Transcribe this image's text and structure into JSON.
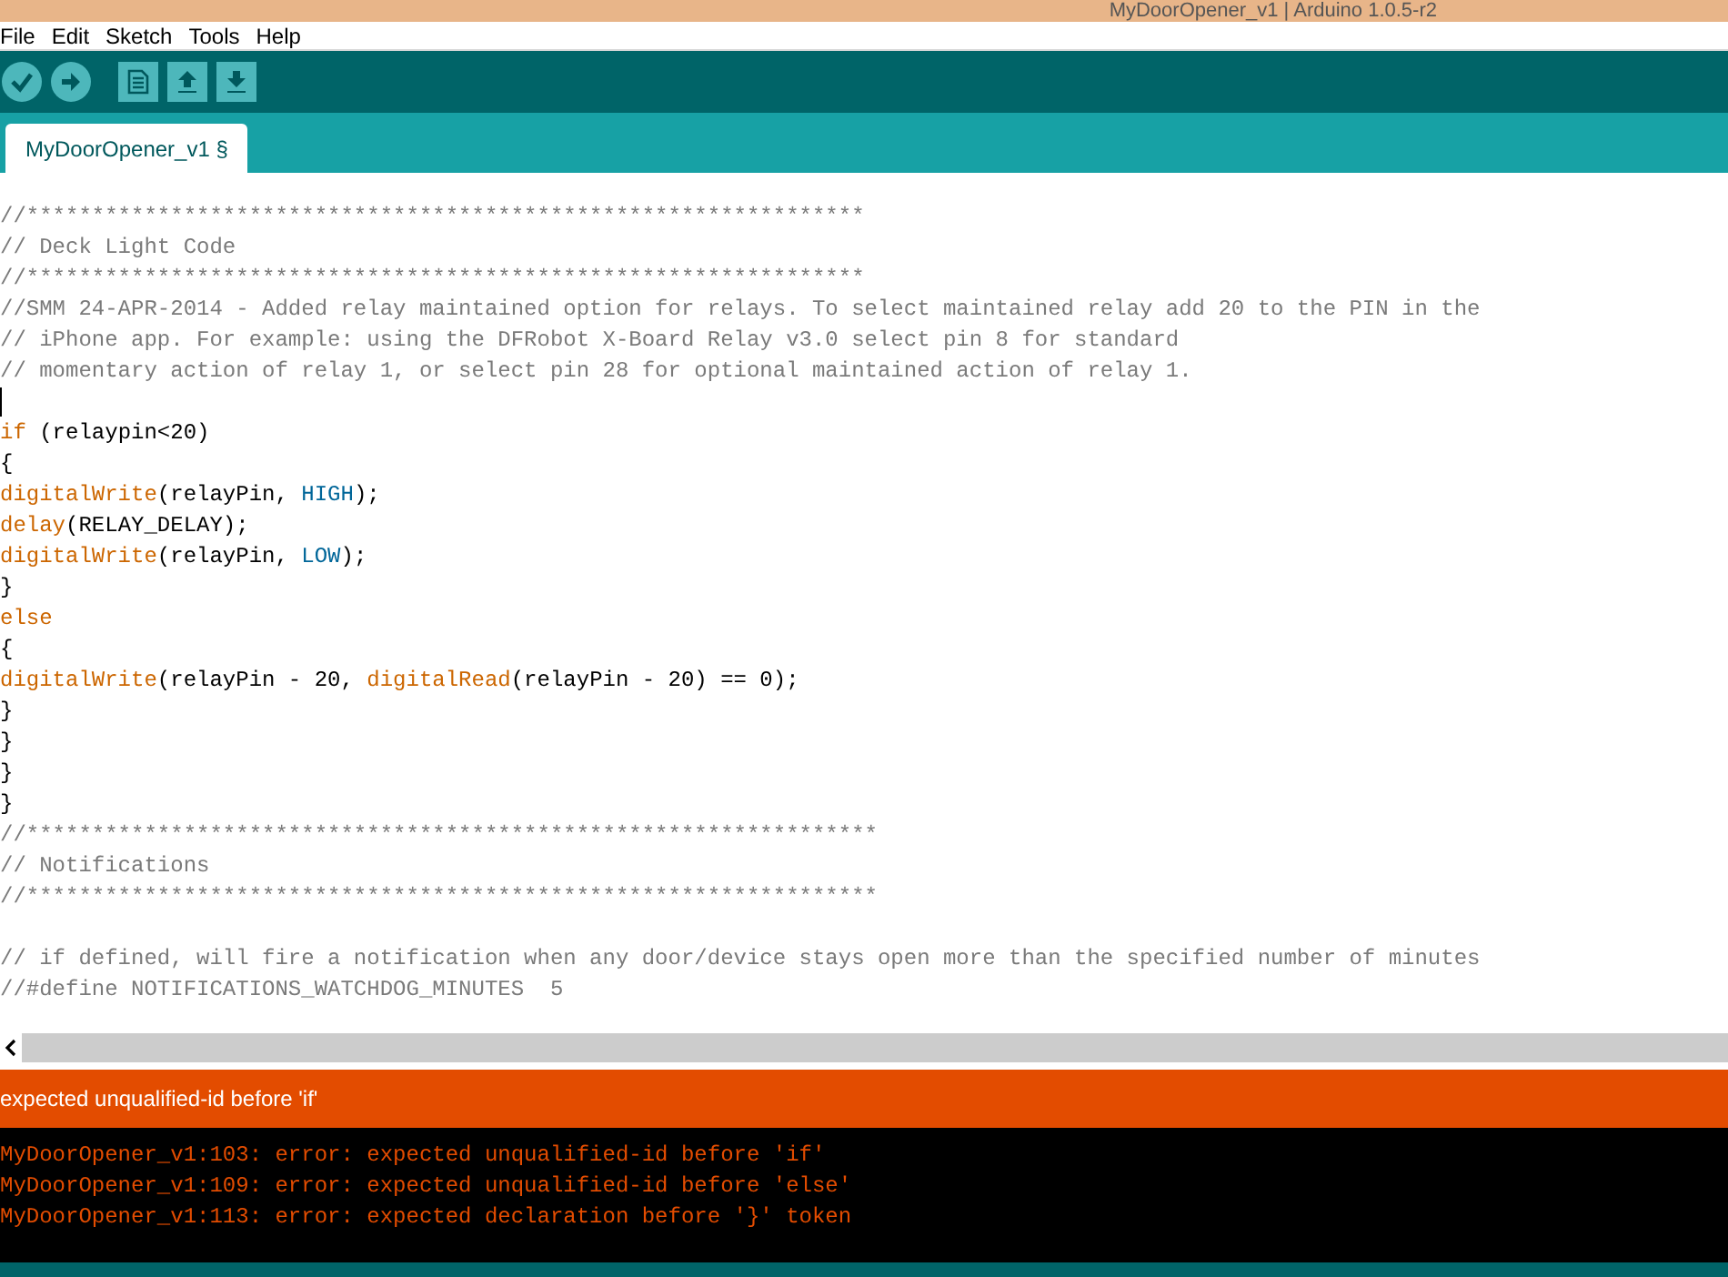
{
  "window": {
    "title": "MyDoorOpener_v1 | Arduino 1.0.5-r2"
  },
  "menu": [
    "File",
    "Edit",
    "Sketch",
    "Tools",
    "Help"
  ],
  "toolbar": [
    {
      "kind": "verify"
    },
    {
      "kind": "upload"
    },
    {
      "kind": "new"
    },
    {
      "kind": "open"
    },
    {
      "kind": "save"
    }
  ],
  "tabs": [
    {
      "label": "MyDoorOpener_v1 §",
      "selected": true
    }
  ],
  "editor": {
    "lines": [
      [
        {
          "text": "//****************************************************************",
          "kind": "comment"
        }
      ],
      [
        {
          "text": "// Deck Light Code",
          "kind": "comment"
        }
      ],
      [
        {
          "text": "//****************************************************************",
          "kind": "comment"
        }
      ],
      [
        {
          "text": "//SMM 24-APR-2014 - Added relay maintained option for relays. To select maintained relay add 20 to the PIN in the",
          "kind": "comment"
        }
      ],
      [
        {
          "text": "// iPhone app. For example: using the DFRobot X-Board Relay v3.0 select pin 8 for standard",
          "kind": "comment"
        }
      ],
      [
        {
          "text": "// momentary action of relay 1, or select pin 28 for optional maintained action of relay 1.",
          "kind": "comment"
        }
      ],
      {
        "kind": "blank",
        "cursor": true
      },
      [
        {
          "text": "if",
          "kind": "keyword"
        },
        {
          "text": " (relaypin<20)",
          "kind": "plain"
        }
      ],
      [
        {
          "text": "{",
          "kind": "plain"
        }
      ],
      [
        {
          "text": "digitalWrite",
          "kind": "keyword"
        },
        {
          "text": "(relayPin, ",
          "kind": "plain"
        },
        {
          "text": "HIGH",
          "kind": "constant"
        },
        {
          "text": ");",
          "kind": "plain"
        }
      ],
      [
        {
          "text": "delay",
          "kind": "keyword"
        },
        {
          "text": "(RELAY_DELAY);",
          "kind": "plain"
        }
      ],
      [
        {
          "text": "digitalWrite",
          "kind": "keyword"
        },
        {
          "text": "(relayPin, ",
          "kind": "plain"
        },
        {
          "text": "LOW",
          "kind": "constant"
        },
        {
          "text": ");",
          "kind": "plain"
        }
      ],
      [
        {
          "text": "}",
          "kind": "plain"
        }
      ],
      [
        {
          "text": "else",
          "kind": "keyword"
        }
      ],
      [
        {
          "text": "{",
          "kind": "plain"
        }
      ],
      [
        {
          "text": "digitalWrite",
          "kind": "keyword"
        },
        {
          "text": "(relayPin - 20, ",
          "kind": "plain"
        },
        {
          "text": "digitalRead",
          "kind": "keyword"
        },
        {
          "text": "(relayPin - 20) == 0);",
          "kind": "plain"
        }
      ],
      [
        {
          "text": "}",
          "kind": "plain"
        }
      ],
      [
        {
          "text": "}",
          "kind": "plain"
        }
      ],
      [
        {
          "text": "}",
          "kind": "plain"
        }
      ],
      [
        {
          "text": "}",
          "kind": "plain"
        }
      ],
      [
        {
          "text": "//*****************************************************************",
          "kind": "comment"
        }
      ],
      [
        {
          "text": "// Notifications",
          "kind": "comment"
        }
      ],
      [
        {
          "text": "//*****************************************************************",
          "kind": "comment"
        }
      ],
      {
        "kind": "blank"
      },
      [
        {
          "text": "// if defined, will fire a notification when any door/device stays open more than the specified number of minutes",
          "kind": "comment"
        }
      ],
      [
        {
          "text": "//#define NOTIFICATIONS_WATCHDOG_MINUTES  5",
          "kind": "comment"
        }
      ]
    ]
  },
  "status": {
    "message": "expected unqualified-id before 'if'"
  },
  "console": {
    "lines": [
      "MyDoorOpener_v1:103: error: expected unqualified-id before 'if'",
      "MyDoorOpener_v1:109: error: expected unqualified-id before 'else'",
      "MyDoorOpener_v1:113: error: expected declaration before '}' token"
    ]
  }
}
